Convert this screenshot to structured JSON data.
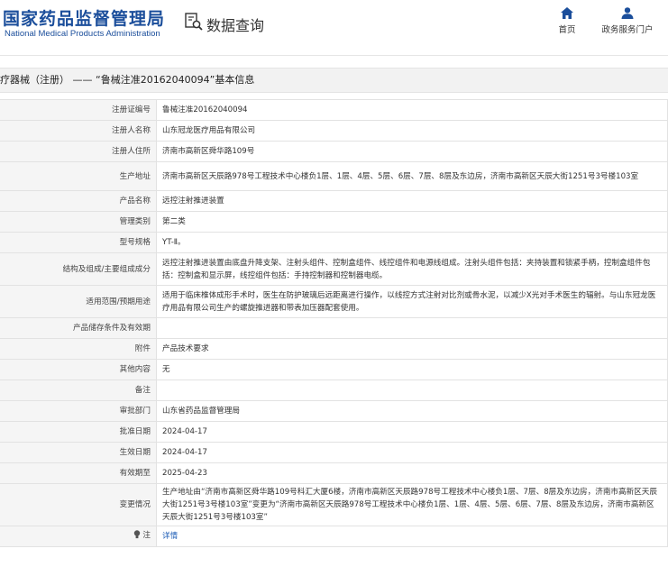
{
  "header": {
    "logo_cn": "国家药品监督管理局",
    "logo_en": "National Medical Products Administration",
    "query_label": "数据查询",
    "nav": [
      {
        "label": "首页",
        "icon": "home-icon"
      },
      {
        "label": "政务服务门户",
        "icon": "user-icon"
      }
    ]
  },
  "section_title": "疗器械（注册） —— “鲁械注准20162040094”基本信息",
  "rows": [
    {
      "key": "注册证编号",
      "value": "鲁械注准20162040094"
    },
    {
      "key": "注册人名称",
      "value": "山东冠龙医疗用品有限公司"
    },
    {
      "key": "注册人住所",
      "value": "济南市高新区舜华路109号"
    },
    {
      "key": "生产地址",
      "value": "济南市高新区天辰路978号工程技术中心楼负1层、1层、4层、5层、6层、7层、8层及东边房，济南市高新区天辰大街1251号3号楼103室"
    },
    {
      "key": "产品名称",
      "value": "远控注射推进装置"
    },
    {
      "key": "管理类别",
      "value": "第二类"
    },
    {
      "key": "型号规格",
      "value": "YT-Ⅱ。"
    },
    {
      "key": "结构及组成/主要组成成分",
      "value": "远控注射推进装置由底盘升降支架、注射头组件、控制盒组件、线控组件和电源线组成。注射头组件包括：夹持装置和锁紧手柄，控制盒组件包括：控制盒和显示屏，线控组件包括：手持控制器和控制器电缆。"
    },
    {
      "key": "适用范围/预期用途",
      "value": "适用于临床椎体成形手术时，医生在防护玻璃后远距离进行操作，以线控方式注射对比剂或骨水泥，以减少X光对手术医生的辐射。与山东冠龙医疗用品有限公司生产的螺旋推进器和带表加压器配套使用。"
    },
    {
      "key": "产品储存条件及有效期",
      "value": ""
    },
    {
      "key": "附件",
      "value": "产品技术要求"
    },
    {
      "key": "其他内容",
      "value": "无"
    },
    {
      "key": "备注",
      "value": ""
    },
    {
      "key": "审批部门",
      "value": "山东省药品监督管理局"
    },
    {
      "key": "批准日期",
      "value": "2024-04-17"
    },
    {
      "key": "生效日期",
      "value": "2024-04-17"
    },
    {
      "key": "有效期至",
      "value": "2025-04-23"
    },
    {
      "key": "变更情况",
      "value": "生产地址由“济南市高新区舜华路109号科汇大厦6楼，济南市高新区天辰路978号工程技术中心楼负1层、7层、8层及东边房，济南市高新区天辰大街1251号3号楼103室”变更为“济南市高新区天辰路978号工程技术中心楼负1层、1层、4层、5层、6层、7层、8层及东边房，济南市高新区天辰大街1251号3号楼103室”"
    },
    {
      "key": "注",
      "value": "详情"
    }
  ],
  "colors": {
    "brand": "#1b4e9b",
    "link": "#1b5bb5",
    "label_bg": "#f5f5f5",
    "title_bg": "#f2f2f2"
  }
}
